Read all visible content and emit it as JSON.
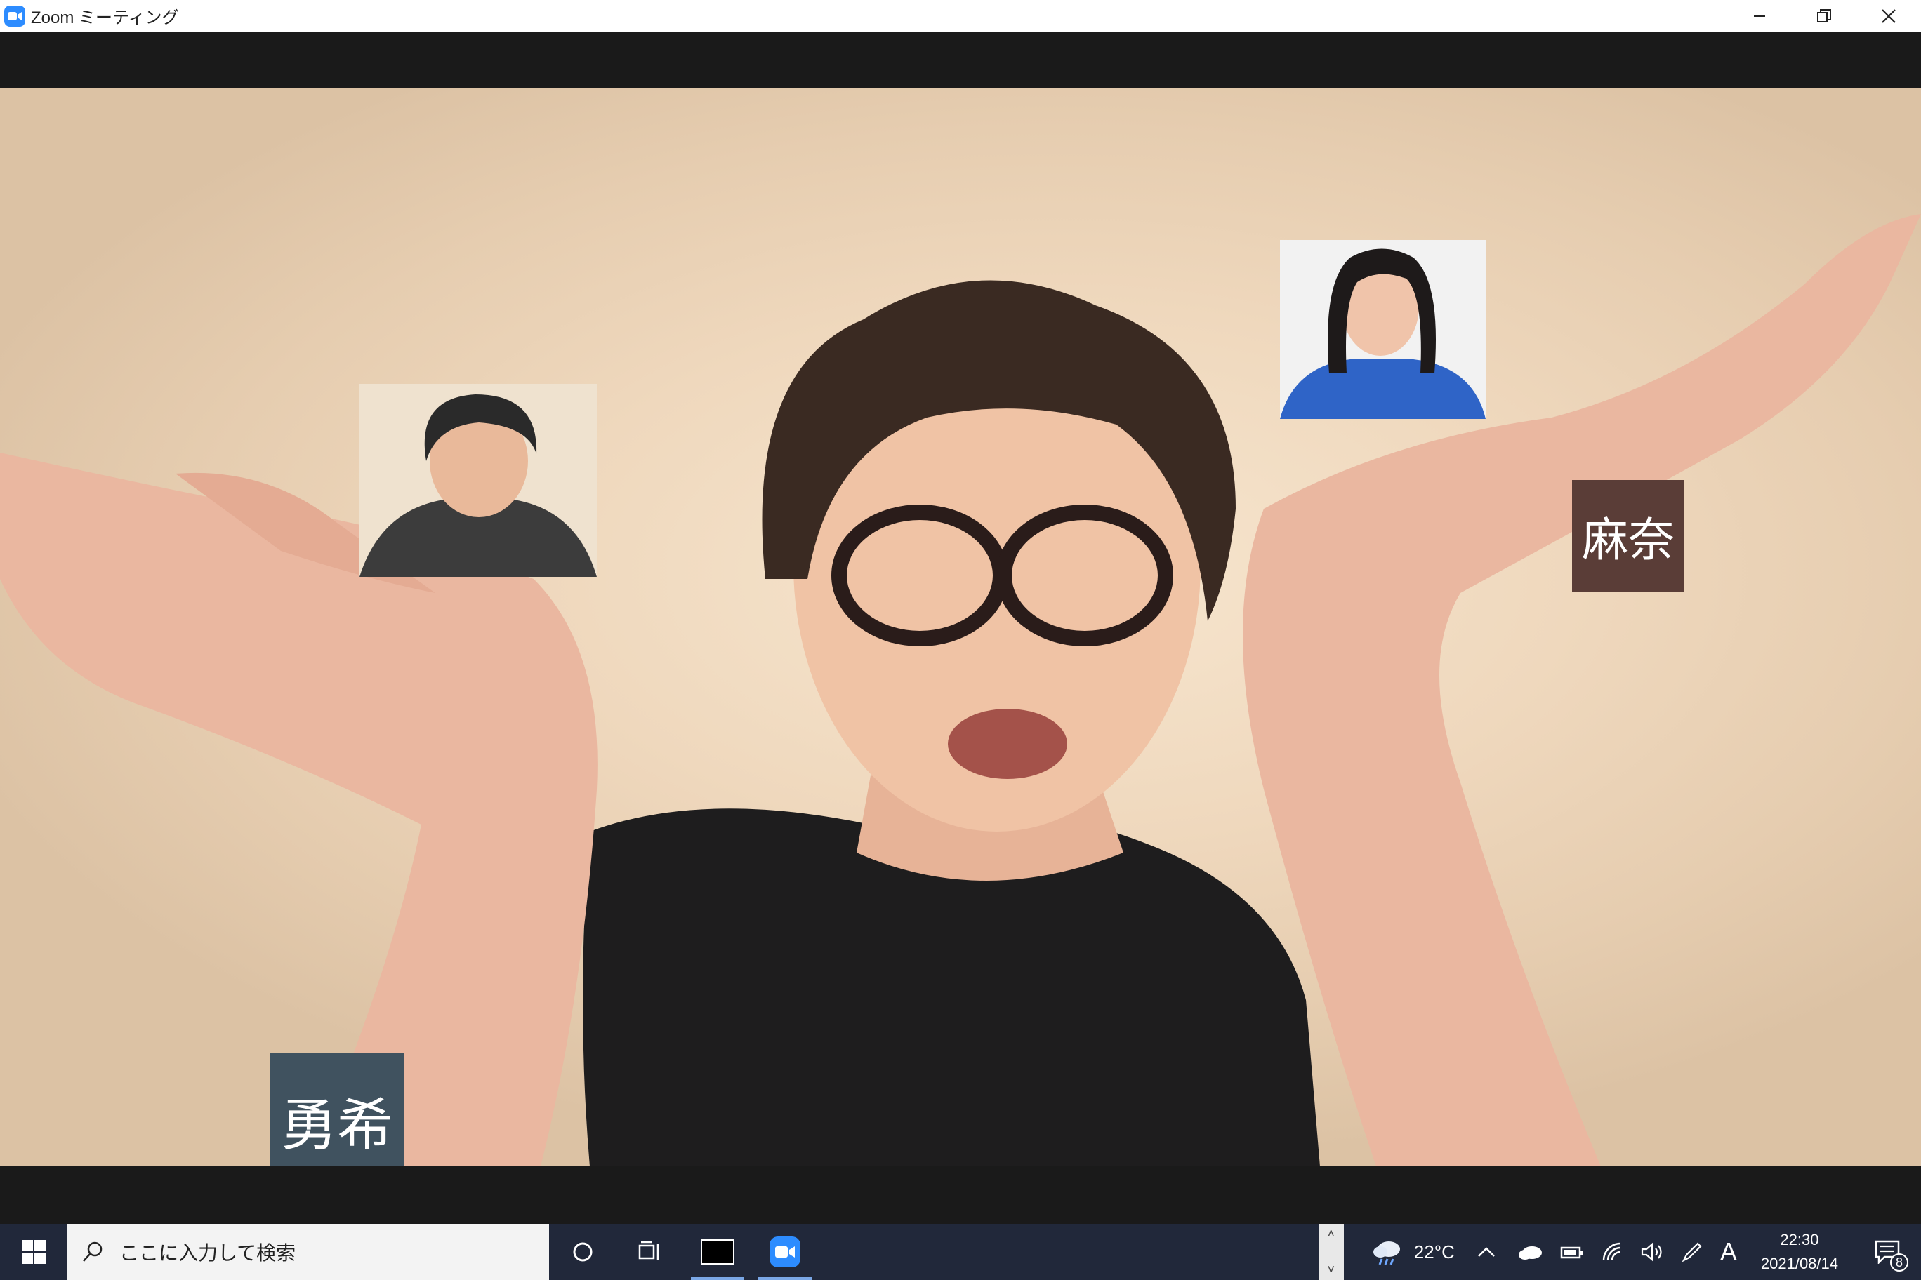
{
  "window": {
    "title": "Zoom ミーティング",
    "controls": [
      "minimize",
      "restore",
      "close"
    ]
  },
  "meeting": {
    "participants": [
      {
        "name": "勇希",
        "tile": "name-tag",
        "color": "#40525f"
      },
      {
        "name": "麻奈",
        "tile": "name-tag",
        "color": "#5a3d37"
      }
    ]
  },
  "taskbar": {
    "search_placeholder": "ここに入力して検索",
    "weather_temp": "22°C",
    "ime": "A",
    "time": "22:30",
    "date": "2021/08/14",
    "notification_count": "8",
    "icons": [
      "windows-start-icon",
      "search-icon",
      "cortana-icon",
      "task-view-icon",
      "terminal-app-icon",
      "zoom-app-icon",
      "weather-icon",
      "tray-chevron-icon",
      "onedrive-icon",
      "battery-icon",
      "wifi-icon",
      "volume-icon",
      "pen-icon",
      "notification-icon"
    ]
  }
}
